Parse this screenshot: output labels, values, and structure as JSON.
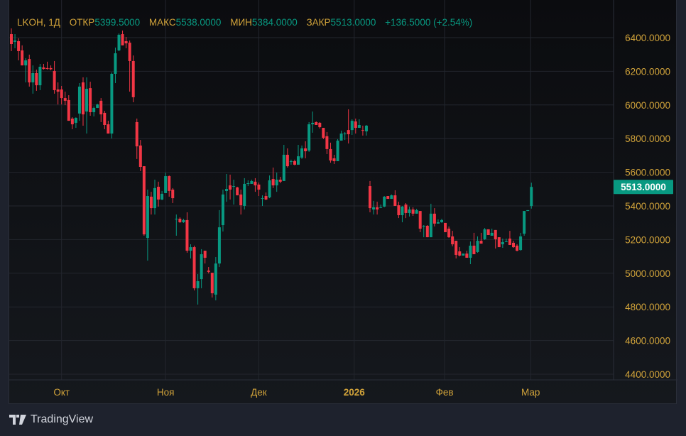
{
  "legend": {
    "symbol": "LKOH, 1Д",
    "open_label": "ОТКР",
    "open": "5399.5000",
    "high_label": "МАКС",
    "high": "5538.0000",
    "low_label": "МИН",
    "low": "5384.0000",
    "close_label": "ЗАКР",
    "close": "5513.0000",
    "change": "+136.5000 (+2.54%)"
  },
  "footer": {
    "brand": "TradingView"
  },
  "colors": {
    "up": "#089981",
    "down": "#f23645",
    "axis_text": "#d1a33a",
    "grid": "#23262e",
    "last_price_bg": "#089981"
  },
  "chart_data": {
    "type": "candlestick",
    "title": "LKOH, 1Д",
    "ylim": [
      4400,
      6400
    ],
    "yticks": [
      "6400.0000",
      "6200.0000",
      "6000.0000",
      "5800.0000",
      "5600.0000",
      "5400.0000",
      "5200.0000",
      "5000.0000",
      "4800.0000",
      "4600.0000",
      "4400.0000"
    ],
    "ytick_values": [
      6400,
      6200,
      6000,
      5800,
      5600,
      5400,
      5200,
      5000,
      4800,
      4600,
      4400
    ],
    "xticks": [
      {
        "label": "Окт",
        "index": 14
      },
      {
        "label": "Ноя",
        "index": 43
      },
      {
        "label": "Дек",
        "index": 69
      },
      {
        "label": "2026",
        "index": 95.6
      },
      {
        "label": "Фев",
        "index": 120.8
      },
      {
        "label": "Мар",
        "index": 144.8
      }
    ],
    "last_price": "5513.0000",
    "last_price_value": 5513,
    "grid": true,
    "ohlc": [
      [
        6421,
        6455,
        6320,
        6362
      ],
      [
        6375,
        6421,
        6337,
        6383
      ],
      [
        6379,
        6396,
        6265,
        6320
      ],
      [
        6324,
        6354,
        6235,
        6235
      ],
      [
        6235,
        6278,
        6134,
        6265
      ],
      [
        6273,
        6299,
        6109,
        6134
      ],
      [
        6134,
        6235,
        6067,
        6189
      ],
      [
        6189,
        6210,
        6084,
        6117
      ],
      [
        6117,
        6244,
        6088,
        6227
      ],
      [
        6223,
        6244,
        6210,
        6214
      ],
      [
        6219,
        6257,
        6210,
        6214
      ],
      [
        6219,
        6235,
        6206,
        6212
      ],
      [
        6202,
        6261,
        6067,
        6088
      ],
      [
        6092,
        6134,
        6003,
        6079
      ],
      [
        6092,
        6113,
        6003,
        6041
      ],
      [
        6041,
        6079,
        5999,
        6025
      ],
      [
        6029,
        6058,
        5906,
        5906
      ],
      [
        5919,
        5927,
        5856,
        5885
      ],
      [
        5894,
        5927,
        5864,
        5923
      ],
      [
        5949,
        6130,
        5906,
        6109
      ],
      [
        6134,
        6164,
        5877,
        5944
      ],
      [
        5961,
        6164,
        5830,
        6096
      ],
      [
        6100,
        6138,
        5936,
        5957
      ],
      [
        5957,
        5991,
        5932,
        5982
      ],
      [
        5982,
        6007,
        5982,
        6003
      ],
      [
        6025,
        6041,
        5898,
        5944
      ],
      [
        5953,
        5965,
        5856,
        5881
      ],
      [
        5885,
        5906,
        5830,
        5830
      ],
      [
        5830,
        6193,
        5801,
        6185
      ],
      [
        6185,
        6341,
        6130,
        6307
      ],
      [
        6324,
        6425,
        6320,
        6417
      ],
      [
        6421,
        6442,
        6354,
        6354
      ],
      [
        6379,
        6404,
        6337,
        6366
      ],
      [
        6370,
        6383,
        6079,
        6261
      ],
      [
        6261,
        6294,
        6016,
        6046
      ],
      [
        5898,
        5919,
        5679,
        5754
      ],
      [
        5759,
        5792,
        5607,
        5632
      ],
      [
        5636,
        5636,
        5223,
        5231
      ],
      [
        5210,
        5497,
        5075,
        5459
      ],
      [
        5455,
        5484,
        5349,
        5387
      ],
      [
        5387,
        5556,
        5349,
        5506
      ],
      [
        5514,
        5544,
        5396,
        5438
      ],
      [
        5438,
        5489,
        5434,
        5472
      ],
      [
        5476,
        5598,
        5476,
        5577
      ],
      [
        5577,
        5581,
        5455,
        5489
      ],
      [
        5497,
        5506,
        5417,
        5446
      ],
      [
        5320,
        5349,
        5223,
        5324
      ],
      [
        5324,
        5332,
        5299,
        5303
      ],
      [
        5303,
        5324,
        5299,
        5316
      ],
      [
        5316,
        5362,
        5122,
        5134
      ],
      [
        5134,
        5172,
        5088,
        5155
      ],
      [
        5155,
        5164,
        4898,
        4911
      ],
      [
        4911,
        4995,
        4814,
        4953
      ],
      [
        4965,
        5143,
        4911,
        5113
      ],
      [
        5134,
        5134,
        5058,
        5092
      ],
      [
        5016,
        5037,
        4999,
        5008
      ],
      [
        5003,
        5003,
        4856,
        4881
      ],
      [
        4873,
        5096,
        4839,
        5058
      ],
      [
        5058,
        5375,
        5037,
        5273
      ],
      [
        5286,
        5497,
        5248,
        5468
      ],
      [
        5489,
        5590,
        5425,
        5501
      ],
      [
        5522,
        5586,
        5438,
        5497
      ],
      [
        5514,
        5556,
        5408,
        5518
      ],
      [
        5510,
        5514,
        5463,
        5463
      ],
      [
        5468,
        5497,
        5349,
        5404
      ],
      [
        5400,
        5565,
        5379,
        5531
      ],
      [
        5531,
        5552,
        5518,
        5535
      ],
      [
        5531,
        5556,
        5531,
        5548
      ],
      [
        5544,
        5565,
        5484,
        5522
      ],
      [
        5527,
        5539,
        5459,
        5497
      ],
      [
        5442,
        5463,
        5400,
        5446
      ],
      [
        5459,
        5480,
        5434,
        5438
      ],
      [
        5451,
        5581,
        5446,
        5552
      ],
      [
        5560,
        5628,
        5506,
        5522
      ],
      [
        5522,
        5598,
        5484,
        5556
      ],
      [
        5556,
        5573,
        5535,
        5544
      ],
      [
        5548,
        5763,
        5548,
        5704
      ],
      [
        5704,
        5742,
        5628,
        5636
      ],
      [
        5662,
        5675,
        5645,
        5666
      ],
      [
        5666,
        5675,
        5641,
        5645
      ],
      [
        5645,
        5763,
        5645,
        5695
      ],
      [
        5687,
        5759,
        5679,
        5742
      ],
      [
        5742,
        5784,
        5683,
        5725
      ],
      [
        5729,
        5898,
        5721,
        5885
      ],
      [
        5885,
        5961,
        5835,
        5894
      ],
      [
        5898,
        5902,
        5881,
        5881
      ],
      [
        5894,
        5898,
        5860,
        5868
      ],
      [
        5864,
        5864,
        5797,
        5805
      ],
      [
        5814,
        5839,
        5708,
        5738
      ],
      [
        5738,
        5776,
        5657,
        5670
      ],
      [
        5683,
        5704,
        5649,
        5666
      ],
      [
        5666,
        5797,
        5666,
        5788
      ],
      [
        5788,
        5847,
        5788,
        5830
      ],
      [
        5826,
        5839,
        5792,
        5830
      ],
      [
        5851,
        5974,
        5771,
        5826
      ],
      [
        5851,
        5915,
        5822,
        5906
      ],
      [
        5902,
        5919,
        5830,
        5864
      ],
      [
        5864,
        5915,
        5864,
        5881
      ],
      [
        5851,
        5877,
        5818,
        5849
      ],
      [
        5843,
        5881,
        5818,
        5877
      ],
      [
        5518,
        5548,
        5362,
        5387
      ],
      [
        5379,
        5430,
        5349,
        5392
      ],
      [
        5392,
        5425,
        5349,
        5379
      ],
      [
        5390,
        5408,
        5387,
        5392
      ],
      [
        5396,
        5459,
        5392,
        5455
      ],
      [
        5459,
        5459,
        5442,
        5442
      ],
      [
        5442,
        5468,
        5442,
        5463
      ],
      [
        5463,
        5493,
        5400,
        5400
      ],
      [
        5404,
        5425,
        5328,
        5345
      ],
      [
        5345,
        5400,
        5303,
        5396
      ],
      [
        5408,
        5417,
        5328,
        5358
      ],
      [
        5358,
        5396,
        5337,
        5379
      ],
      [
        5379,
        5392,
        5341,
        5354
      ],
      [
        5354,
        5383,
        5354,
        5375
      ],
      [
        5370,
        5370,
        5244,
        5265
      ],
      [
        5278,
        5286,
        5214,
        5282
      ],
      [
        5282,
        5286,
        5214,
        5214
      ],
      [
        5214,
        5413,
        5214,
        5354
      ],
      [
        5354,
        5387,
        5278,
        5295
      ],
      [
        5295,
        5320,
        5295,
        5303
      ],
      [
        5303,
        5324,
        5299,
        5316
      ],
      [
        5299,
        5299,
        5244,
        5244
      ],
      [
        5265,
        5278,
        5210,
        5214
      ],
      [
        5219,
        5252,
        5160,
        5172
      ],
      [
        5193,
        5193,
        5088,
        5109
      ],
      [
        5130,
        5155,
        5100,
        5105
      ],
      [
        5105,
        5117,
        5105,
        5117
      ],
      [
        5117,
        5134,
        5092,
        5092
      ],
      [
        5092,
        5189,
        5054,
        5164
      ],
      [
        5164,
        5240,
        5113,
        5113
      ],
      [
        5126,
        5219,
        5122,
        5193
      ],
      [
        5193,
        5240,
        5176,
        5176
      ],
      [
        5202,
        5269,
        5198,
        5261
      ],
      [
        5261,
        5261,
        5227,
        5227
      ],
      [
        5223,
        5265,
        5223,
        5240
      ],
      [
        5257,
        5257,
        5147,
        5202
      ],
      [
        5214,
        5214,
        5155,
        5155
      ],
      [
        5172,
        5206,
        5151,
        5185
      ],
      [
        5185,
        5206,
        5185,
        5189
      ],
      [
        5206,
        5252,
        5168,
        5168
      ],
      [
        5181,
        5193,
        5151,
        5155
      ],
      [
        5164,
        5172,
        5130,
        5134
      ],
      [
        5138,
        5240,
        5134,
        5219
      ],
      [
        5235,
        5370,
        5223,
        5370
      ],
      [
        5370,
        5375,
        5370,
        5375
      ],
      [
        5399.5,
        5538,
        5384,
        5513
      ]
    ]
  }
}
